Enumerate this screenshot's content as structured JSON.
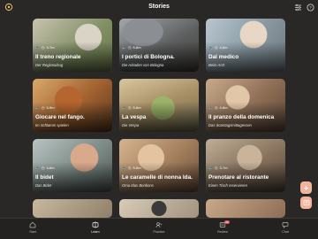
{
  "header": {
    "title": "Stories"
  },
  "stories": [
    {
      "duration": "3-7m",
      "title": "Il treno regionale",
      "subtitle": "Der Regionalzug"
    },
    {
      "duration": "5-8m",
      "title": "I portici di Bologna.",
      "subtitle": "Die Arkaden von Bologna"
    },
    {
      "duration": "4-6m",
      "title": "Dal medico",
      "subtitle": "Beim Arzt"
    },
    {
      "duration": "5-9m",
      "title": "Giocare nel fango.",
      "subtitle": "Im Schlamm spielen"
    },
    {
      "duration": "5-8m",
      "title": "La vespa",
      "subtitle": "Die Vespa"
    },
    {
      "duration": "4-8m",
      "title": "Il pranzo della domenica",
      "subtitle": "Das Sonntagsmittagessen"
    },
    {
      "duration": "4-6m",
      "title": "Il bidet",
      "subtitle": "Das Bidet"
    },
    {
      "duration": "5-8m",
      "title": "Le caramelle di nonna Ida.",
      "subtitle": "Oma Idas Bonbons"
    },
    {
      "duration": "3-7m",
      "title": "Prenotare al ristorante",
      "subtitle": "Einen Tisch reservieren"
    }
  ],
  "bottom_nav": [
    {
      "label": "Start",
      "icon": "home-icon"
    },
    {
      "label": "Learn",
      "icon": "learn-icon",
      "active": true
    },
    {
      "label": "Practice",
      "icon": "practice-icon"
    },
    {
      "label": "Review",
      "icon": "review-icon",
      "badge": "80"
    },
    {
      "label": "Chat",
      "icon": "chat-icon"
    }
  ],
  "colors": {
    "background": "#2a2826",
    "fab": "#f4b39a",
    "badge": "#d9544a"
  }
}
